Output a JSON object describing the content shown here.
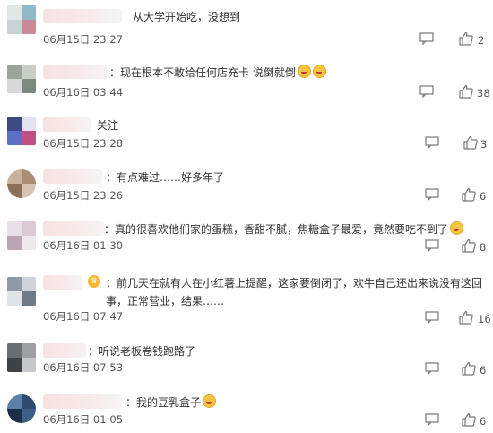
{
  "comments": [
    {
      "text": "从大学开始吃，没想到",
      "time": "06月15日 23:27",
      "likes": "2"
    },
    {
      "text": "：现在根本不敢给任何店充卡 说倒就倒",
      "time": "06月16日 03:44",
      "likes": "38"
    },
    {
      "text": "关注",
      "time": "06月15日 23:28",
      "likes": "3"
    },
    {
      "text": "：有点难过……好多年了",
      "time": "06月15日 23:26",
      "likes": "6"
    },
    {
      "text": "：真的很喜欢他们家的蛋糕，香甜不腻，焦糖盒子最爱，竟然要吃不到了",
      "time": "06月16日 01:30",
      "likes": "8"
    },
    {
      "text": "：前几天在就有人在小红薯上提醒，这家要倒闭了，欢牛自己还出来说没有这回事，正常营业，结果……",
      "time": "06月16日 07:47",
      "likes": "16"
    },
    {
      "text": "：听说老板卷钱跑路了",
      "time": "06月16日 07:53",
      "likes": "6"
    },
    {
      "text": "：我的豆乳盒子",
      "time": "06月16日 01:05",
      "likes": "6"
    }
  ],
  "icons": {
    "reply": "comment-icon",
    "like": "thumbs-up-icon",
    "emoji": "emoji-face-icon"
  }
}
